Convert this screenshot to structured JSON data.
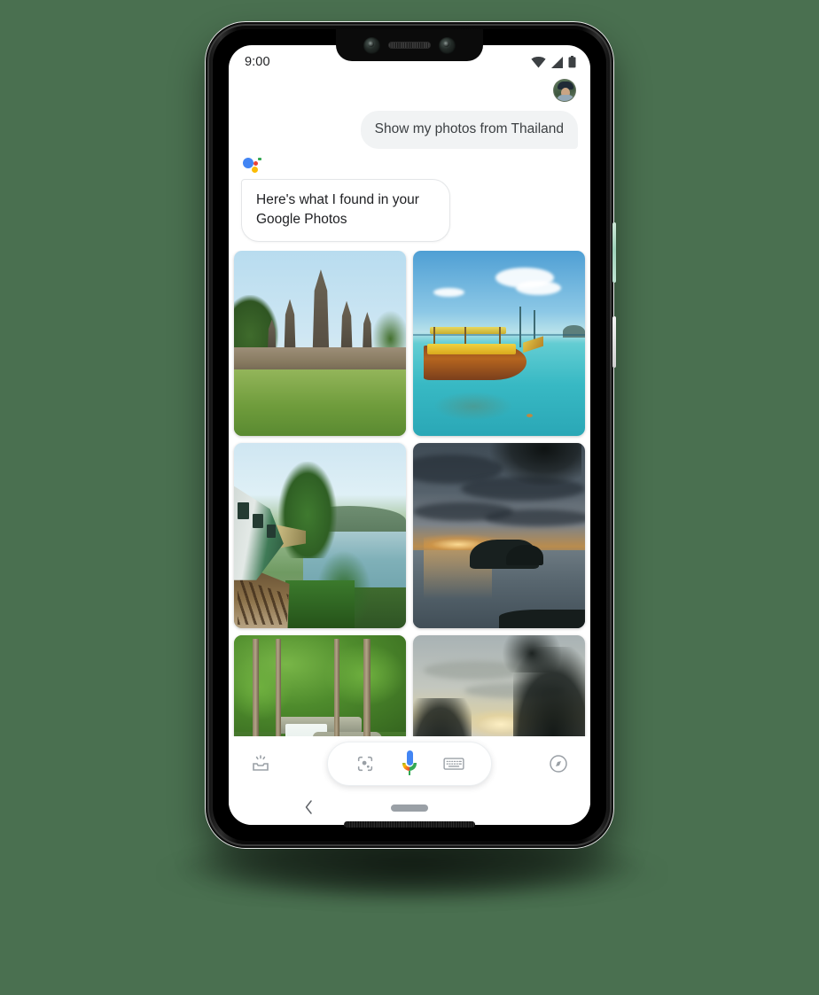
{
  "background_color": "#4a7050",
  "device": {
    "name": "Google Pixel 3 XL",
    "frame_color": "#0c0c0c",
    "power_button_color": "#bfe3d3",
    "volume_button_color": "#e8e8e8"
  },
  "status_bar": {
    "time": "9:00",
    "icons": [
      "wifi-icon",
      "cellular-signal-icon",
      "battery-icon"
    ]
  },
  "account": {
    "avatar_label": "Google account avatar"
  },
  "conversation": {
    "user_message": "Show my photos from Thailand",
    "assistant_logo": "google-assistant-logo",
    "assistant_message": "Here's what I found in your Google Photos",
    "user_bubble_color": "#f1f3f4",
    "assistant_bubble_color": "#ffffff"
  },
  "photo_grid": {
    "photos": [
      {
        "id": "photo-1",
        "alt": "Ayutthaya temple ruins with stone prangs and green lawn"
      },
      {
        "id": "photo-2",
        "alt": "Longtail boat on turquoise tropical water"
      },
      {
        "id": "photo-3",
        "alt": "Train on the Death Railway beside the River Kwai"
      },
      {
        "id": "photo-4",
        "alt": "Dramatic sunset over the sea with dark clouds and rocks"
      },
      {
        "id": "photo-5",
        "alt": "Waterfall in the jungle with turquoise pool"
      },
      {
        "id": "photo-6",
        "alt": "Sunset over the sea framed by silhouetted trees"
      }
    ]
  },
  "bottom_bar": {
    "left_icon": "snapshot-inbox-icon",
    "right_icon": "explore-compass-icon",
    "pill_items": [
      {
        "name": "google-lens-icon",
        "label": "Lens"
      },
      {
        "name": "google-mic-icon",
        "label": "Microphone"
      },
      {
        "name": "keyboard-icon",
        "label": "Keyboard"
      }
    ]
  },
  "nav_bar": {
    "back": "back-chevron-icon",
    "home": "gesture-home-pill"
  },
  "brand_colors": {
    "blue": "#4285f4",
    "red": "#ea4335",
    "yellow": "#fbbc05",
    "green": "#34a853"
  }
}
